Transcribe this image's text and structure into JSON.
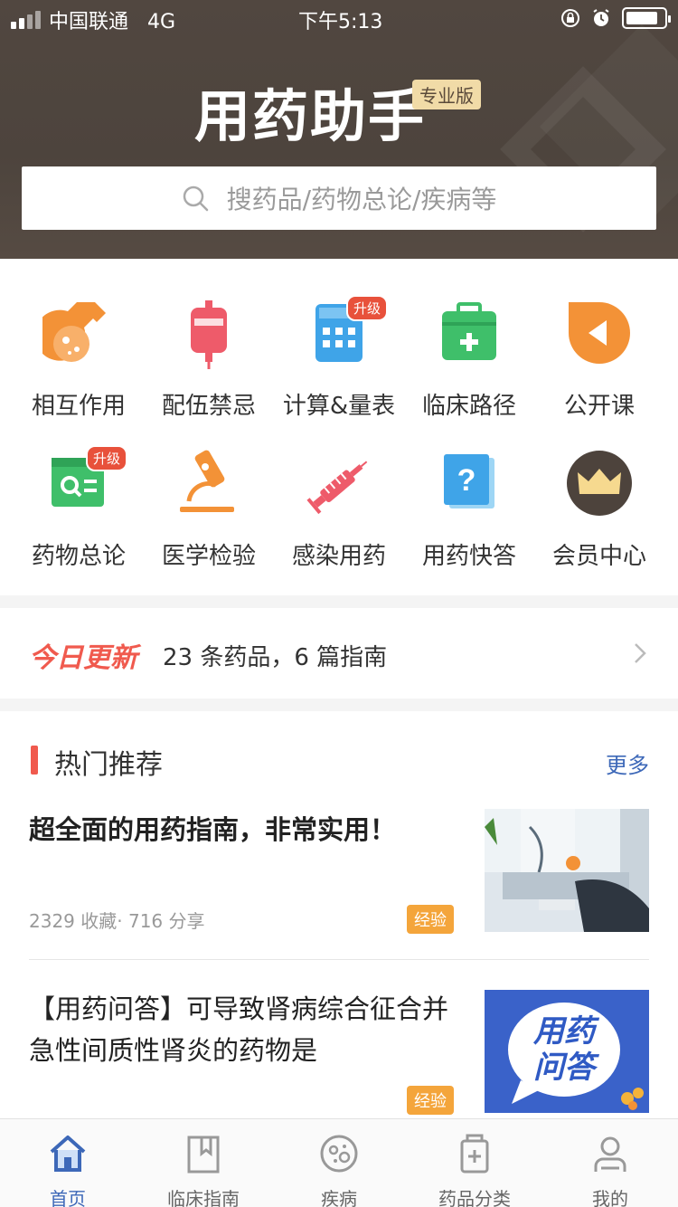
{
  "status_bar": {
    "carrier": "中国联通",
    "network": "4G",
    "time": "下午5:13"
  },
  "header": {
    "logo_text": "用药助手",
    "badge": "专业版"
  },
  "search": {
    "placeholder": "搜药品/药物总论/疾病等"
  },
  "grid": {
    "items": [
      {
        "label": "相互作用",
        "icon": "flask-icon"
      },
      {
        "label": "配伍禁忌",
        "icon": "iv-bag-icon"
      },
      {
        "label": "计算&量表",
        "icon": "calculator-icon",
        "badge": "升级"
      },
      {
        "label": "临床路径",
        "icon": "medical-kit-icon"
      },
      {
        "label": "公开课",
        "icon": "play-icon"
      },
      {
        "label": "药物总论",
        "icon": "drug-search-icon",
        "badge": "升级"
      },
      {
        "label": "医学检验",
        "icon": "microscope-icon"
      },
      {
        "label": "感染用药",
        "icon": "syringe-icon"
      },
      {
        "label": "用药快答",
        "icon": "question-book-icon"
      },
      {
        "label": "会员中心",
        "icon": "crown-icon"
      }
    ]
  },
  "today": {
    "tag": "今日更新",
    "text": "23 条药品，6 篇指南"
  },
  "hot": {
    "title": "热门推荐",
    "more": "更多",
    "articles": [
      {
        "title": "超全面的用药指南，非常实用！",
        "meta": "2329 收藏· 716 分享",
        "tag": "经验"
      },
      {
        "title": "【用药问答】可导致肾病综合征合并急性间质性肾炎的药物是",
        "tag": "经验",
        "image_text": "用药问答"
      }
    ]
  },
  "tabbar": {
    "items": [
      {
        "label": "首页",
        "icon": "home-icon",
        "active": true
      },
      {
        "label": "临床指南",
        "icon": "guide-book-icon"
      },
      {
        "label": "疾病",
        "icon": "disease-icon"
      },
      {
        "label": "药品分类",
        "icon": "medicine-bottle-icon"
      },
      {
        "label": "我的",
        "icon": "profile-icon"
      }
    ]
  },
  "colors": {
    "header_bg": "#4f453e",
    "accent_red": "#f05a4e",
    "link_blue": "#3d68b8",
    "tag_orange": "#f4a53b"
  }
}
